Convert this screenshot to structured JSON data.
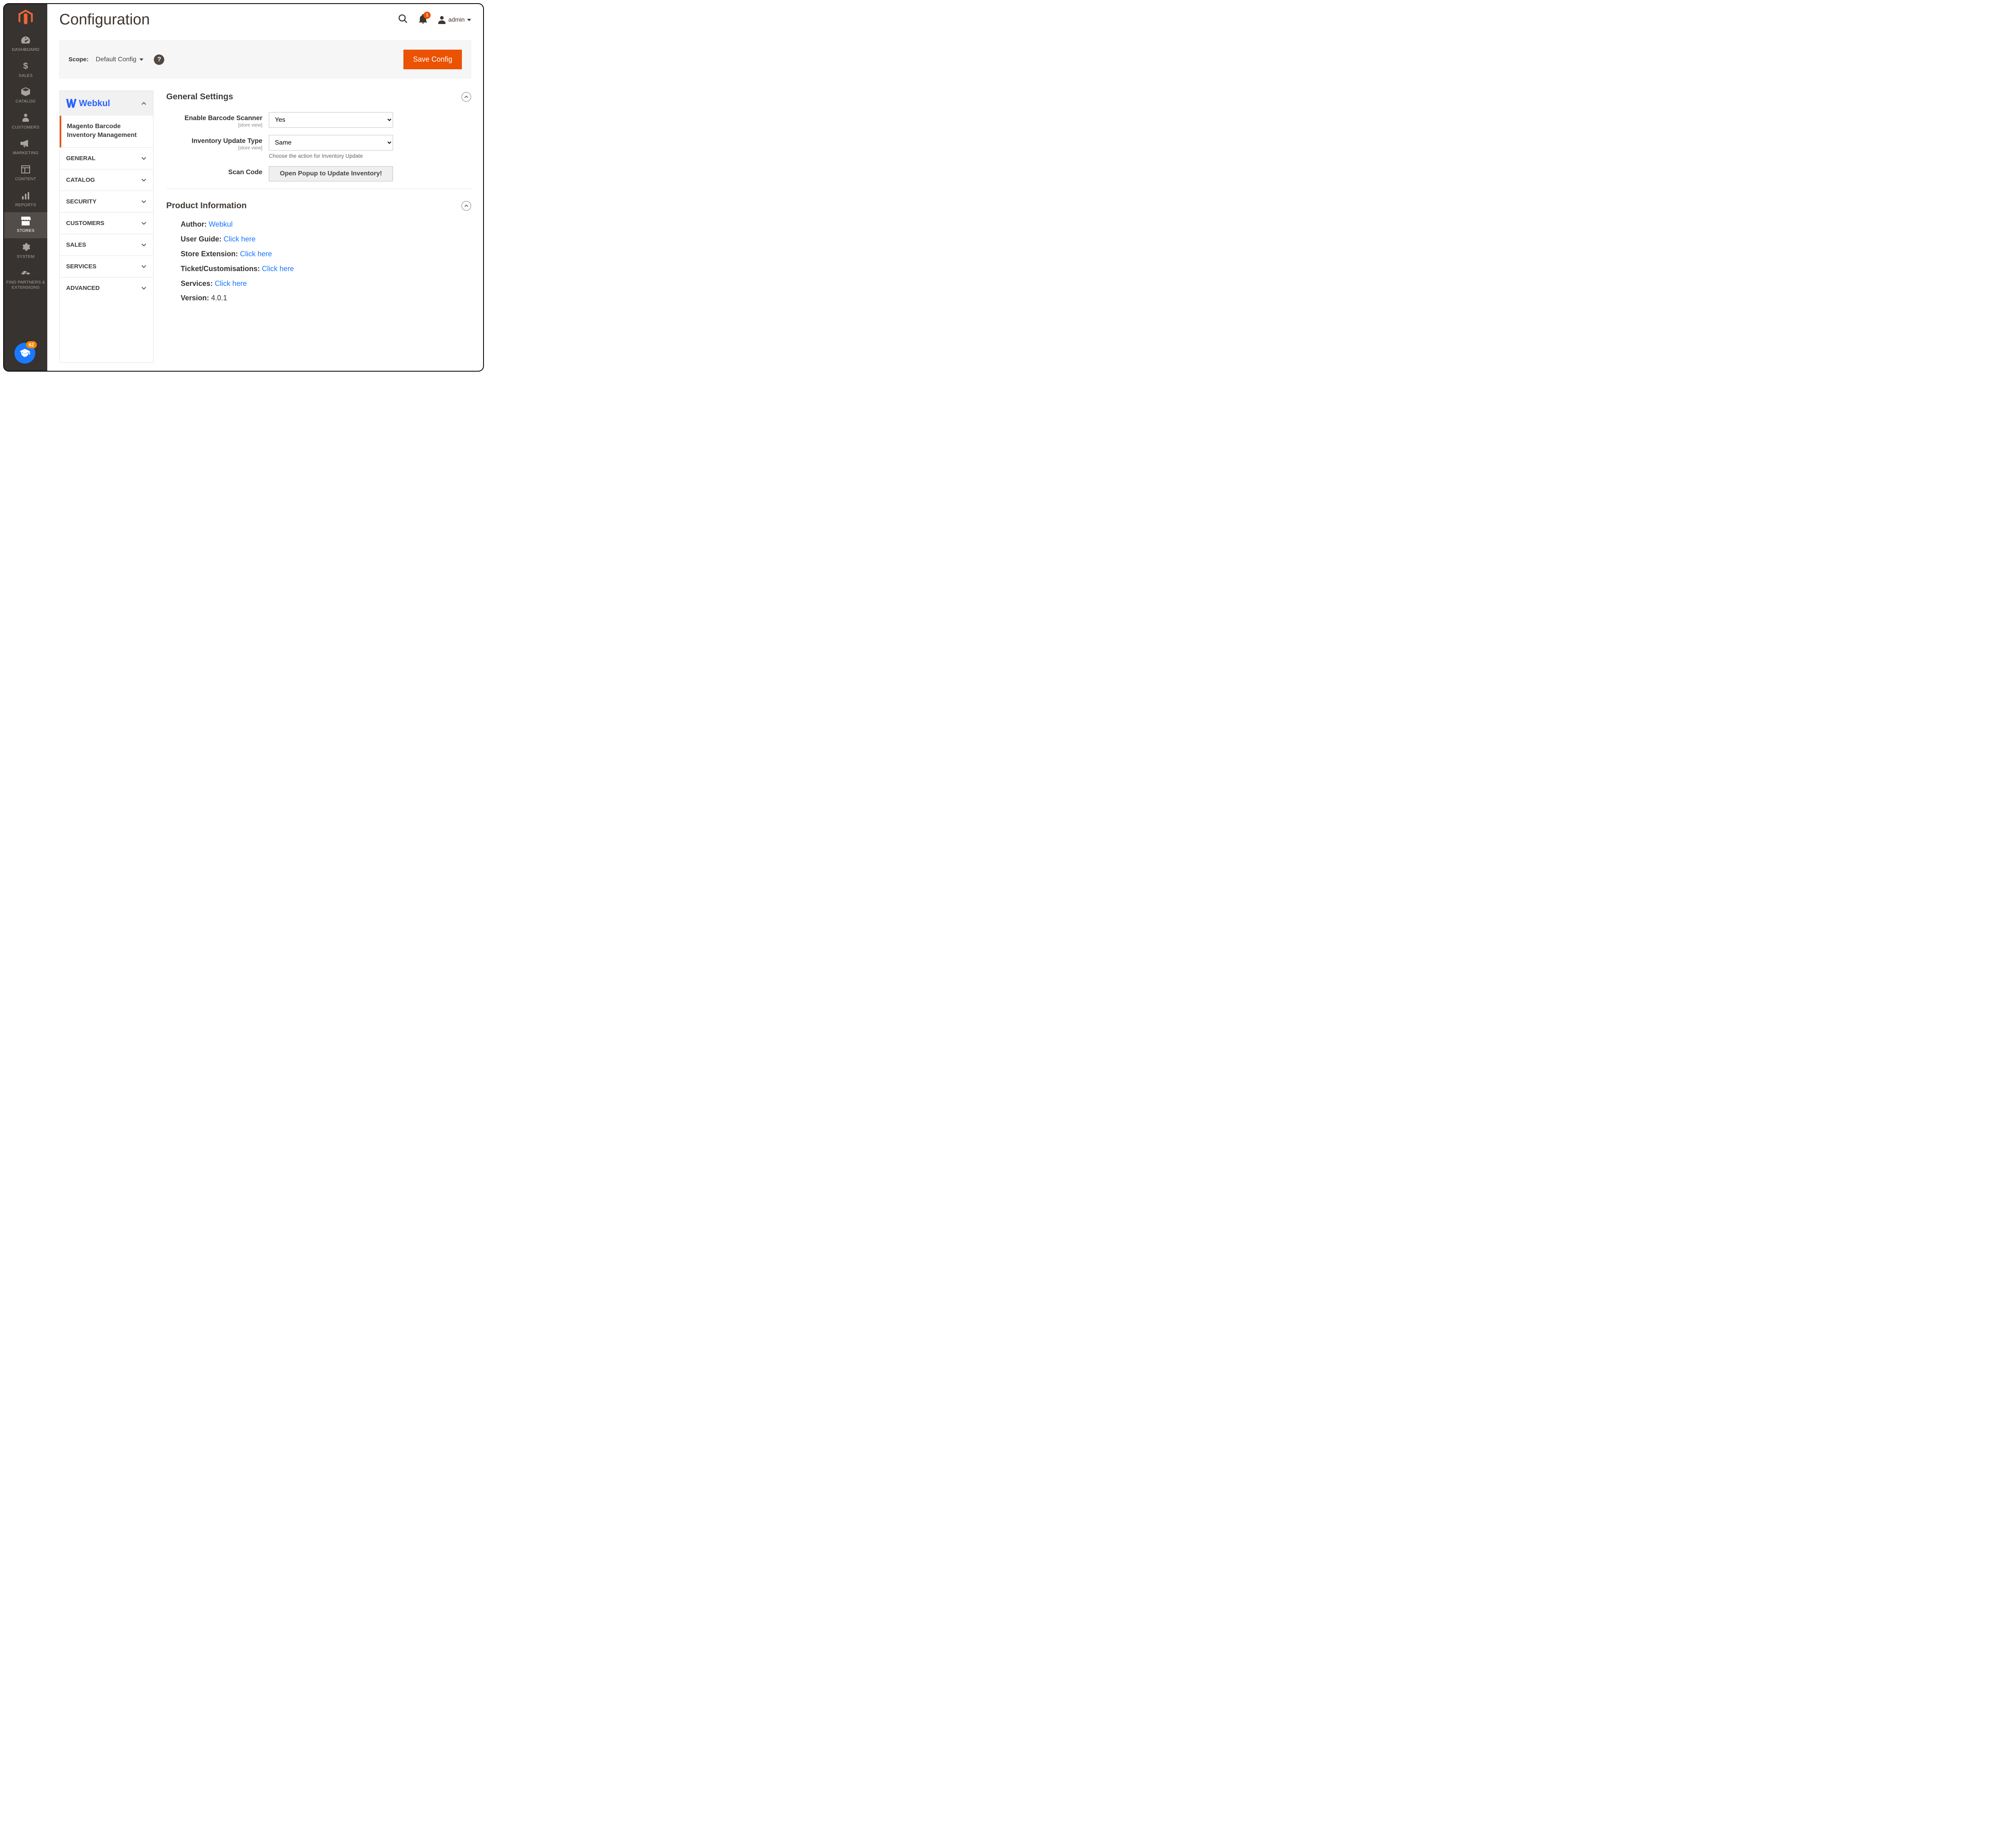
{
  "page": {
    "title": "Configuration"
  },
  "top": {
    "notif_count": "1",
    "admin_user": "admin"
  },
  "scope": {
    "label": "Scope:",
    "value": "Default Config",
    "save_label": "Save Config"
  },
  "nav": {
    "items": [
      {
        "label": "DASHBOARD"
      },
      {
        "label": "SALES"
      },
      {
        "label": "CATALOG"
      },
      {
        "label": "CUSTOMERS"
      },
      {
        "label": "MARKETING"
      },
      {
        "label": "CONTENT"
      },
      {
        "label": "REPORTS"
      },
      {
        "label": "STORES"
      },
      {
        "label": "SYSTEM"
      },
      {
        "label": "FIND PARTNERS & EXTENSIONS"
      }
    ],
    "help_count": "62"
  },
  "tabs": {
    "vendor_name": "Webkul",
    "active_sub": "Magento Barcode Inventory Management",
    "groups": [
      {
        "label": "GENERAL"
      },
      {
        "label": "CATALOG"
      },
      {
        "label": "SECURITY"
      },
      {
        "label": "CUSTOMERS"
      },
      {
        "label": "SALES"
      },
      {
        "label": "SERVICES"
      },
      {
        "label": "ADVANCED"
      }
    ]
  },
  "sections": {
    "general": {
      "title": "General Settings",
      "fields": {
        "enable": {
          "label": "Enable Barcode Scanner",
          "scope": "[store view]",
          "value": "Yes"
        },
        "update_type": {
          "label": "Inventory Update Type",
          "scope": "[store view]",
          "value": "Same",
          "hint": "Choose the action for Inventory Update"
        },
        "scan": {
          "label": "Scan Code",
          "button": "Open Popup to Update Inventory!"
        }
      }
    },
    "product_info": {
      "title": "Product Information",
      "rows": {
        "author": {
          "label": "Author: ",
          "link": "Webkul"
        },
        "guide": {
          "label": "User Guide: ",
          "link": "Click here"
        },
        "store": {
          "label": "Store Extension: ",
          "link": "Click here"
        },
        "ticket": {
          "label": "Ticket/Customisations: ",
          "link": "Click here"
        },
        "services": {
          "label": "Services: ",
          "link": "Click here"
        },
        "version": {
          "label": "Version: ",
          "value": "4.0.1"
        }
      }
    }
  }
}
